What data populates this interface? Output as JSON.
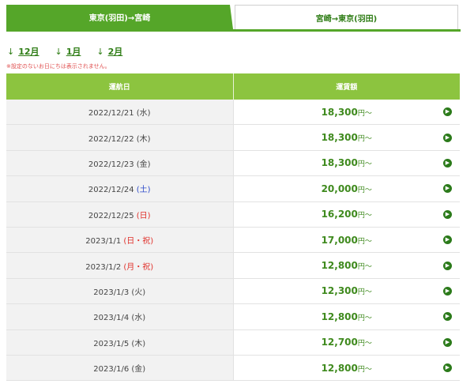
{
  "tabs": [
    {
      "label": "東京(羽田)→宮崎",
      "active": true
    },
    {
      "label": "宮崎→東京(羽田)",
      "active": false
    }
  ],
  "months": [
    {
      "arrow": "↓",
      "label": "12月"
    },
    {
      "arrow": "↓",
      "label": "1月"
    },
    {
      "arrow": "↓",
      "label": "2月"
    }
  ],
  "note": "※設定のないお日にちは表示されません。",
  "table": {
    "headers": [
      "運航日",
      "運賃額"
    ],
    "fare_suffix": "円〜",
    "rows": [
      {
        "date": "2022/12/21",
        "day": "(水)",
        "day_type": "weekday",
        "fare": "18,300"
      },
      {
        "date": "2022/12/22",
        "day": "(木)",
        "day_type": "weekday",
        "fare": "18,300"
      },
      {
        "date": "2022/12/23",
        "day": "(金)",
        "day_type": "weekday",
        "fare": "18,300"
      },
      {
        "date": "2022/12/24",
        "day": "(土)",
        "day_type": "saturday",
        "fare": "20,000"
      },
      {
        "date": "2022/12/25",
        "day": "(日)",
        "day_type": "holiday",
        "fare": "16,200"
      },
      {
        "date": "2023/1/1",
        "day": "(日・祝)",
        "day_type": "holiday",
        "fare": "17,000"
      },
      {
        "date": "2023/1/2",
        "day": "(月・祝)",
        "day_type": "holiday",
        "fare": "12,800"
      },
      {
        "date": "2023/1/3",
        "day": "(火)",
        "day_type": "weekday",
        "fare": "12,300"
      },
      {
        "date": "2023/1/4",
        "day": "(水)",
        "day_type": "weekday",
        "fare": "12,800"
      },
      {
        "date": "2023/1/5",
        "day": "(木)",
        "day_type": "weekday",
        "fare": "12,700"
      },
      {
        "date": "2023/1/6",
        "day": "(金)",
        "day_type": "weekday",
        "fare": "12,800"
      }
    ]
  },
  "colors": {
    "tab_active": "#55a629",
    "header_bg": "#8cc43f",
    "fare_text": "#3f8a1e",
    "saturday": "#2e4bc9",
    "holiday": "#e0302a"
  },
  "icons": {
    "row_action": "chevron-right-circle-icon"
  }
}
